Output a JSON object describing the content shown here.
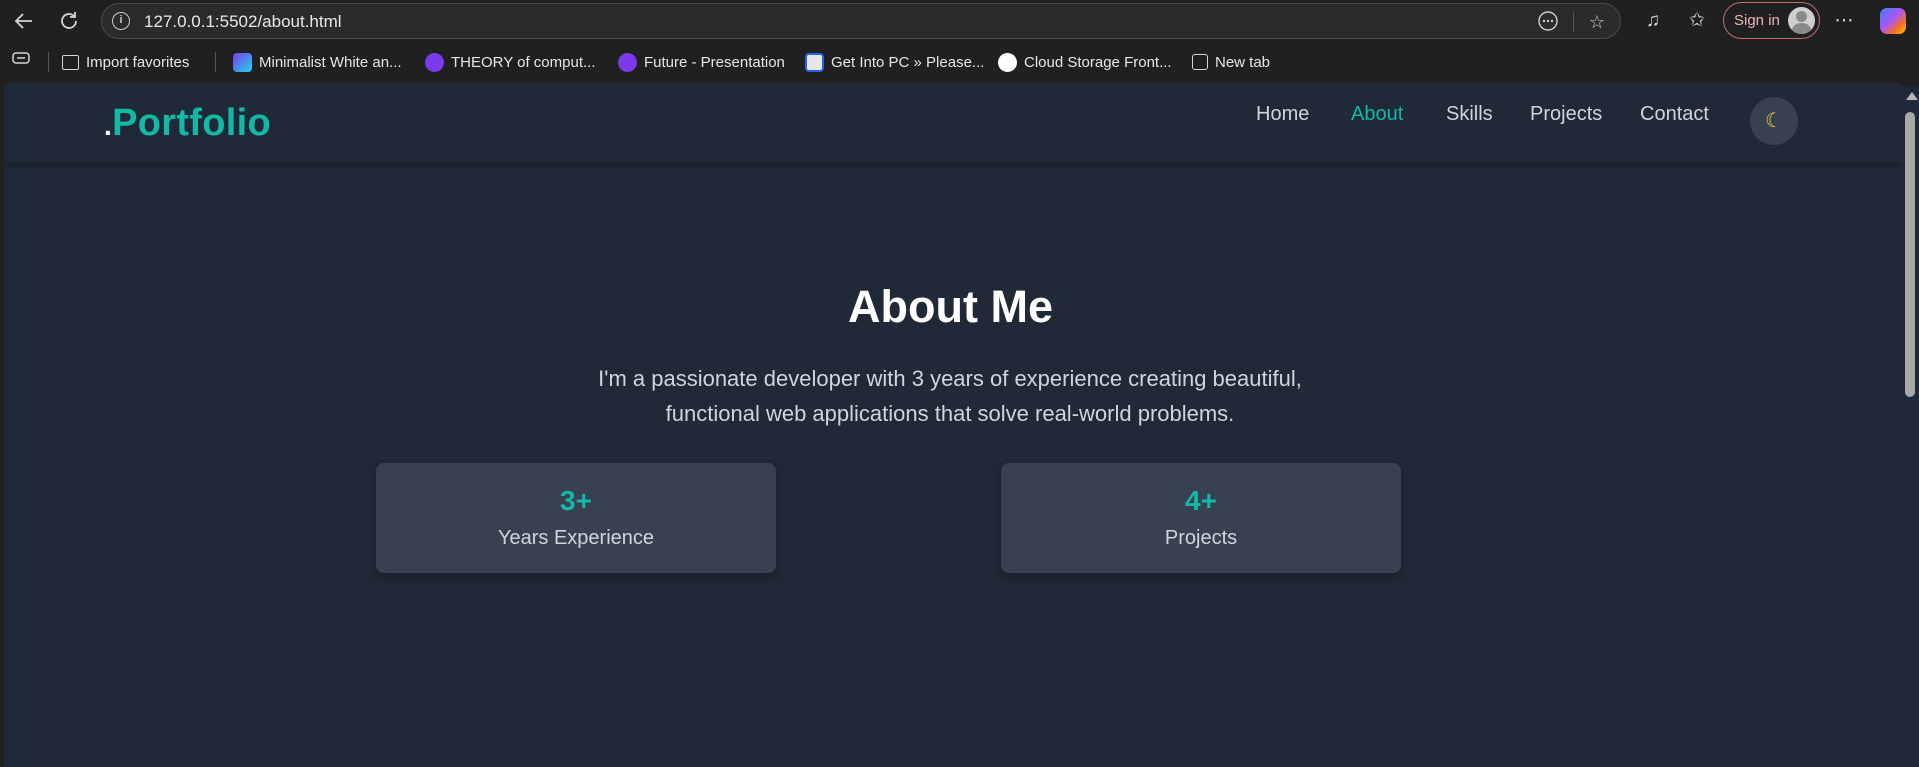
{
  "browser": {
    "url": "127.0.0.1:5502/about.html",
    "sign_in_label": "Sign in",
    "favorites": [
      {
        "label": "Import favorites",
        "icon": "import-icon"
      },
      {
        "label": "Minimalist White an...",
        "icon": "canva-icon"
      },
      {
        "label": "THEORY of comput...",
        "icon": "presentation-icon"
      },
      {
        "label": "Future - Presentation",
        "icon": "presentation-icon"
      },
      {
        "label": "Get Into PC » Please...",
        "icon": "getintopc-icon"
      },
      {
        "label": "Cloud Storage Front...",
        "icon": "openai-icon"
      },
      {
        "label": "New tab",
        "icon": "newtab-icon"
      }
    ]
  },
  "site": {
    "logo_dot": ".",
    "logo": "Portfolio",
    "nav": [
      "Home",
      "About",
      "Skills",
      "Projects",
      "Contact"
    ],
    "active_nav": "About",
    "theme_toggle_icon": "moon-icon",
    "accent_color": "#14b8a6",
    "background_color": "#1f2937"
  },
  "about": {
    "title": "About Me",
    "line1": "I'm a passionate developer with 3 years of experience creating beautiful,",
    "line2": "functional web applications that solve real-world problems.",
    "stats": [
      {
        "value": "3+",
        "label": "Years Experience"
      },
      {
        "value": "4+",
        "label": "Projects"
      }
    ]
  }
}
